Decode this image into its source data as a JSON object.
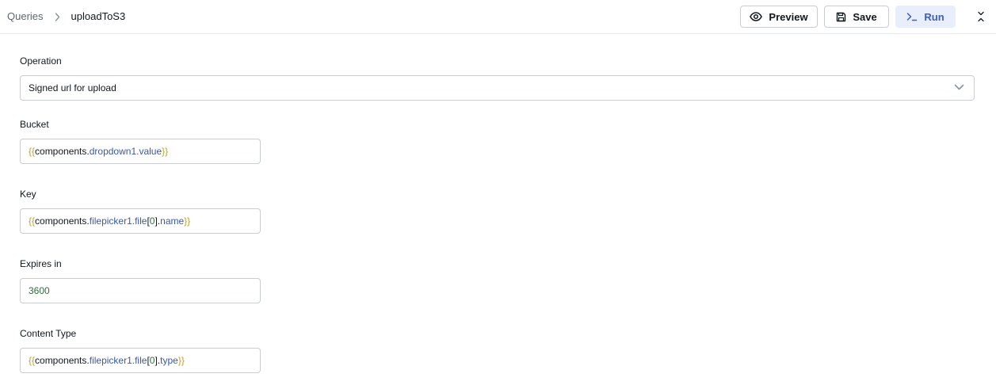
{
  "header": {
    "breadcrumb_root": "Queries",
    "breadcrumb_current": "uploadToS3",
    "preview_label": "Preview",
    "save_label": "Save",
    "run_label": "Run"
  },
  "form": {
    "operation": {
      "label": "Operation",
      "value": "Signed url for upload"
    },
    "bucket": {
      "label": "Bucket",
      "tokens": {
        "open": "{{",
        "obj": "components.",
        "prop": "dropdown1.value",
        "close": "}}"
      }
    },
    "key": {
      "label": "Key",
      "tokens": {
        "open": "{{",
        "obj": "components.",
        "p1": "filepicker1.file",
        "b1": "[",
        "idx": "0",
        "b2": "].",
        "p2": "name",
        "close": "}}"
      }
    },
    "expires": {
      "label": "Expires in",
      "value": "3600"
    },
    "content_type": {
      "label": "Content Type",
      "tokens": {
        "open": "{{",
        "obj": "components.",
        "p1": "filepicker1.file",
        "b1": "[",
        "idx": "0",
        "b2": "].",
        "p2": "type",
        "close": "}}"
      }
    }
  },
  "icons": {
    "breadcrumb_separator": "chevron-right-icon",
    "preview": "eye-icon",
    "save": "floppy-disk-icon",
    "run": "terminal-prompt-icon",
    "collapse": "collapse-vertical-icon",
    "select": "chevron-down-icon"
  },
  "colors": {
    "run_background": "#e8eefb",
    "run_text": "#3a5ccc",
    "template_braces": "#b8a22d",
    "template_property": "#3b57a7",
    "number_value": "#2f6b3f"
  }
}
